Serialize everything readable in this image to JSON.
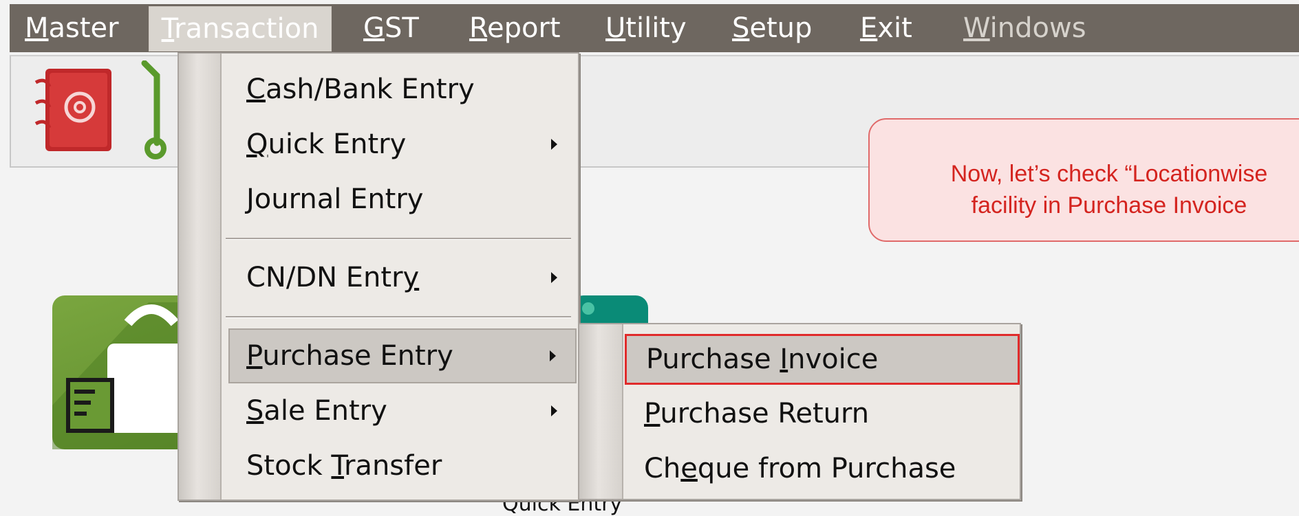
{
  "menubar": {
    "items": [
      {
        "label": "Master"
      },
      {
        "label": "Transaction"
      },
      {
        "label": "GST"
      },
      {
        "label": "Report"
      },
      {
        "label": "Utility"
      },
      {
        "label": "Setup"
      },
      {
        "label": "Exit"
      },
      {
        "label": "Windows"
      }
    ]
  },
  "transaction_menu": {
    "items": [
      {
        "label": "Cash/Bank Entry",
        "has_submenu": false
      },
      {
        "label": "Quick Entry",
        "has_submenu": true
      },
      {
        "label": "Journal Entry",
        "has_submenu": false
      },
      {
        "label": "CN/DN Entry",
        "has_submenu": true
      },
      {
        "label": "Purchase Entry",
        "has_submenu": true,
        "highlighted": true
      },
      {
        "label": "Sale Entry",
        "has_submenu": true
      },
      {
        "label": "Stock Transfer",
        "has_submenu": false
      }
    ]
  },
  "purchase_submenu": {
    "items": [
      {
        "label": "Purchase Invoice",
        "selected": true
      },
      {
        "label": "Purchase Return"
      },
      {
        "label": "Cheque from Purchase"
      }
    ]
  },
  "callout": {
    "line1": "Now, let’s check “Locationwise",
    "line2": "facility in Purchase Invoice"
  },
  "desktop": {
    "partial_label": "Quick Entry"
  },
  "colors": {
    "menubar_bg": "#6e6760",
    "callout_text": "#d4241f",
    "selection_border": "#e02b2b"
  }
}
